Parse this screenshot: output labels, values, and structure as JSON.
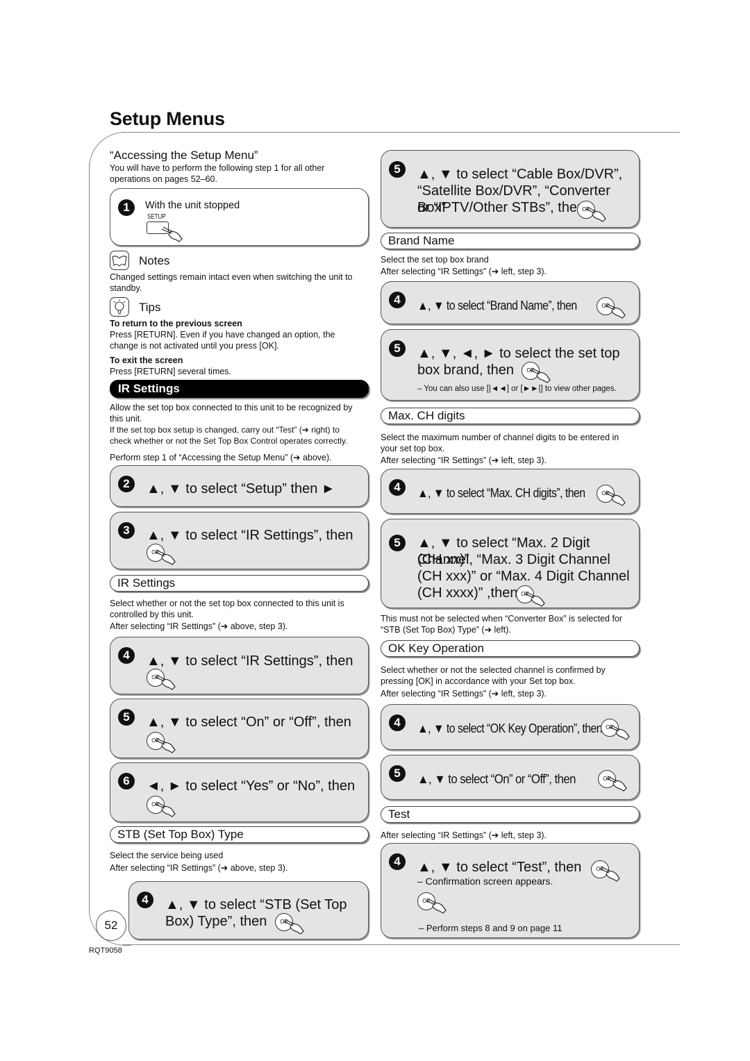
{
  "page": {
    "title": "Setup Menus",
    "page_number": "52",
    "doc_code": "RQT9058"
  },
  "left": {
    "accessing": {
      "heading": "“Accessing the Setup Menu”",
      "desc_line1": "You will have to perform the following step 1 for all other",
      "desc_line2": "operations on pages 52–60.",
      "step1": {
        "num": "1",
        "text": "With the unit stopped",
        "button_label": "SETUP"
      }
    },
    "notes": {
      "title": "Notes",
      "line1": "Changed settings remain intact even when switching the unit to",
      "line2": "standby."
    },
    "tips": {
      "title": "Tips",
      "tip1_title": "To return to the previous screen",
      "tip1_line1": "Press [RETURN]. Even if you have changed an option, the",
      "tip1_line2": "change is not activated until you press [OK].",
      "tip2_title": "To exit the screen",
      "tip2_line1": "Press [RETURN] several times."
    },
    "ir_settings_section": {
      "header": "IR Settings",
      "desc_line1": "Allow the set top box connected to this unit to be recognized by",
      "desc_line2": "this unit.",
      "desc_line3": "If the set top box setup is changed, carry out “Test” (➔ right) to",
      "desc_line4": "check whether or not the Set Top Box Control operates correctly.",
      "perform": "Perform step 1 of “Accessing the Setup Menu” (➔ above).",
      "step2": {
        "num": "2",
        "text": "▲, ▼ to select “Setup” then ►"
      },
      "step3": {
        "num": "3",
        "text": "▲, ▼ to select “IR Settings”, then"
      }
    },
    "ir_settings_item": {
      "label": "IR Settings",
      "desc_line1": "Select whether or not the set top box connected to this unit is",
      "desc_line2": "controlled by this unit.",
      "after": "After selecting “IR Settings” (➔ above, step 3).",
      "step4": {
        "num": "4",
        "text": "▲, ▼ to select “IR Settings”, then"
      },
      "step5": {
        "num": "5",
        "text": "▲, ▼ to select “On” or “Off”, then"
      },
      "step6": {
        "num": "6",
        "text": "◄, ► to select “Yes” or “No”, then"
      }
    },
    "stb_type": {
      "label": "STB (Set Top Box) Type",
      "desc": "Select the service being used",
      "after": "After selecting “IR Settings” (➔ above, step 3).",
      "step4": {
        "num": "4",
        "line1": "▲, ▼ to select “STB (Set Top",
        "line2": "Box) Type”, then"
      }
    }
  },
  "right": {
    "stb_step5": {
      "num": "5",
      "line1": "▲, ▼ to select “Cable Box/DVR”,",
      "line2": "“Satellite Box/DVR”, “Converter Box”",
      "line3": "or “IPTV/Other STBs”, then"
    },
    "brand_name": {
      "label": "Brand Name",
      "desc": "Select the set top box brand",
      "after": "After selecting “IR Settings” (➔ left, step 3).",
      "step4": {
        "num": "4",
        "text": "▲, ▼ to select “Brand Name”, then"
      },
      "step5": {
        "num": "5",
        "line1": "▲, ▼, ◄, ► to select the set top",
        "line2": "box brand, then",
        "note": "– You can also use [|◄◄] or [►►|] to view other pages."
      }
    },
    "max_ch": {
      "label": "Max. CH digits",
      "desc_line1": "Select the maximum number of channel digits to be entered in",
      "desc_line2": "your set top box.",
      "after": "After selecting “IR Settings” (➔ left, step 3).",
      "step4": {
        "num": "4",
        "text": "▲, ▼ to select “Max. CH digits”, then"
      },
      "step5": {
        "num": "5",
        "line1": "▲, ▼ to select “Max. 2 Digit Channel",
        "line2": "(CH xx)”, “Max. 3 Digit Channel",
        "line3": "(CH xxx)” or “Max. 4 Digit Channel",
        "line4": "(CH xxxx)” ,then"
      },
      "warn_line1": "This must not be selected when “Converter Box” is selected for",
      "warn_line2": "“STB (Set Top Box) Type” (➔ left)."
    },
    "ok_key": {
      "label": "OK Key Operation",
      "desc_line1": "Select whether or not the selected channel is confirmed by",
      "desc_line2": "pressing [OK] in accordance with your Set top box.",
      "after": "After selecting “IR Settings” (➔ left, step 3).",
      "step4": {
        "num": "4",
        "text": "▲, ▼ to select “OK Key Operation”, then"
      },
      "step5": {
        "num": "5",
        "text": "▲, ▼ to select “On” or “Off”, then"
      }
    },
    "test": {
      "label": "Test",
      "after": "After selecting “IR Settings” (➔ left, step 3).",
      "step4": {
        "num": "4",
        "text": "▲, ▼ to select “Test”, then",
        "note1": "– Confirmation screen appears.",
        "note2": "– Perform steps 8 and 9 on page 11"
      }
    }
  },
  "ok_label": "OK"
}
